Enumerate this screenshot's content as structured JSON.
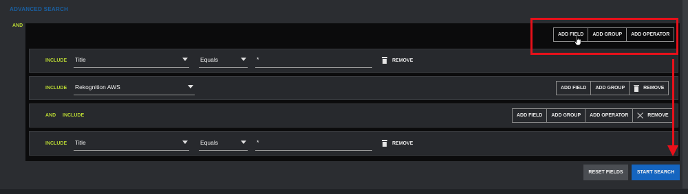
{
  "header": {
    "title": "ADVANCED SEARCH"
  },
  "root_operator": "AND",
  "root_toolbar": {
    "add_field": "ADD FIELD",
    "add_group": "ADD GROUP",
    "add_operator": "ADD OPERATOR"
  },
  "rows": [
    {
      "include": "INCLUDE",
      "field": "Title",
      "condition": "Equals",
      "value": "*",
      "remove": "REMOVE"
    },
    {
      "include": "INCLUDE",
      "group": "Rekognition AWS",
      "add_field": "ADD FIELD",
      "add_group": "ADD GROUP",
      "remove": "REMOVE"
    },
    {
      "operator": "AND",
      "include": "INCLUDE",
      "add_field": "ADD FIELD",
      "add_group": "ADD GROUP",
      "add_operator": "ADD OPERATOR",
      "remove": "REMOVE"
    },
    {
      "include": "INCLUDE",
      "field": "Title",
      "condition": "Equals",
      "value": "*",
      "remove": "REMOVE"
    }
  ],
  "footer": {
    "reset": "RESET FIELDS",
    "start": "START SEARCH"
  },
  "colors": {
    "accent_blue": "#1565c0",
    "include_green": "#b6d433",
    "annotation_red": "#e8101a"
  },
  "icons": [
    "trash-icon",
    "close-icon",
    "chevron-down-icon",
    "hand-pointer-icon"
  ]
}
